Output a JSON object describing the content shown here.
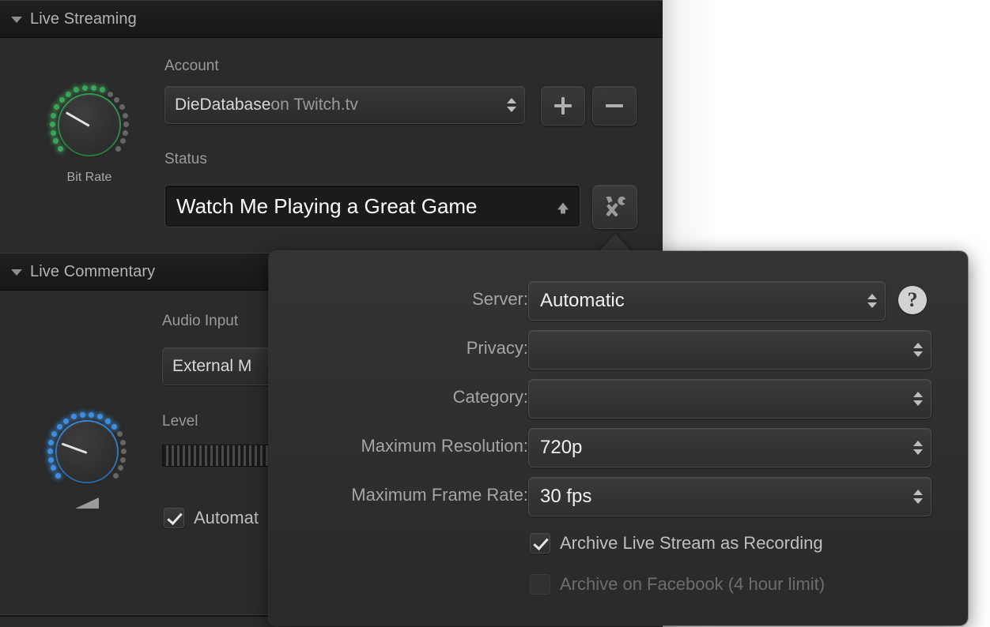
{
  "window": {
    "sections": [
      {
        "title": "Live Streaming",
        "collapsed_icon": "disclosure-triangle-down"
      },
      {
        "title": "Live Commentary",
        "collapsed_icon": "disclosure-triangle-down"
      }
    ]
  },
  "live_streaming": {
    "knob": {
      "label": "Bit Rate",
      "accent_color": "#3ea35a",
      "needle_angle_deg": 210,
      "lit_leds": 12,
      "total_leds": 20
    },
    "account": {
      "label": "Account",
      "value_primary": "DieDatabase",
      "value_secondary": " on Twitch.tv",
      "control": "popup-button"
    },
    "add_button": {
      "label": "+",
      "icon": "plus-icon"
    },
    "remove_button": {
      "label": "−",
      "icon": "minus-icon"
    },
    "status": {
      "label": "Status",
      "value": "Watch Me Playing a Great Game",
      "control": "combo-box"
    },
    "tools_button": {
      "icon": "hammer-wrench-icon",
      "tooltip": "Settings"
    }
  },
  "live_commentary": {
    "knob": {
      "label": "",
      "accent_color": "#3e8fe0",
      "needle_angle_deg": 200,
      "lit_leds": 14,
      "total_leds": 20,
      "volume_icon": "volume-triangle-icon"
    },
    "audio_input": {
      "label": "Audio Input",
      "value": "External M",
      "control": "popup-button"
    },
    "level": {
      "label": "Level",
      "meter": "audio-level-meter"
    },
    "automatic_checkbox": {
      "label": "Automat",
      "checked": true
    }
  },
  "popover": {
    "rows": [
      {
        "label": "Server:",
        "value": "Automatic",
        "enabled": true,
        "has_help": true
      },
      {
        "label": "Privacy:",
        "value": "",
        "enabled": true,
        "has_help": false
      },
      {
        "label": "Category:",
        "value": "",
        "enabled": true,
        "has_help": false
      },
      {
        "label": "Maximum Resolution:",
        "value": "720p",
        "enabled": true,
        "has_help": false
      },
      {
        "label": "Maximum Frame Rate:",
        "value": "30 fps",
        "enabled": true,
        "has_help": false
      }
    ],
    "help_button": {
      "glyph": "?",
      "icon": "help-icon"
    },
    "checkboxes": [
      {
        "label": "Archive Live Stream as Recording",
        "checked": true,
        "enabled": true
      },
      {
        "label": "Archive on Facebook (4 hour limit)",
        "checked": false,
        "enabled": false
      }
    ]
  },
  "colors": {
    "window_background": "#2b2b2b",
    "header_background": "#1c1c1c",
    "popover_background": "#313131",
    "text_primary": "#f0f0f0",
    "text_secondary": "#a5a5a5",
    "text_disabled": "#6d6d6d",
    "knob_green": "#3ea35a",
    "knob_blue": "#3e8fe0"
  }
}
